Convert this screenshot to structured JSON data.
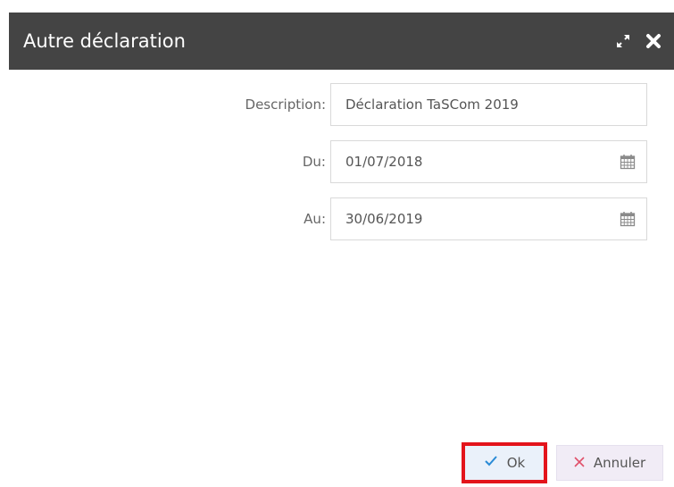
{
  "dialog": {
    "title": "Autre déclaration",
    "icons": {
      "expand": "expand-icon",
      "close": "close-icon"
    }
  },
  "form": {
    "description": {
      "label": "Description:",
      "value": "Déclaration TaSCom 2019"
    },
    "du": {
      "label": "Du:",
      "value": "01/07/2018",
      "icon": "calendar-icon"
    },
    "au": {
      "label": "Au:",
      "value": "30/06/2019",
      "icon": "calendar-icon"
    }
  },
  "buttons": {
    "ok": {
      "label": "Ok",
      "icon": "check-icon",
      "color": "#2a8bd6",
      "highlight": "#e3141b"
    },
    "cancel": {
      "label": "Annuler",
      "icon": "x-icon",
      "color": "#e0506a"
    }
  },
  "colors": {
    "titlebar": "#444444",
    "title_text": "#ffffff"
  }
}
